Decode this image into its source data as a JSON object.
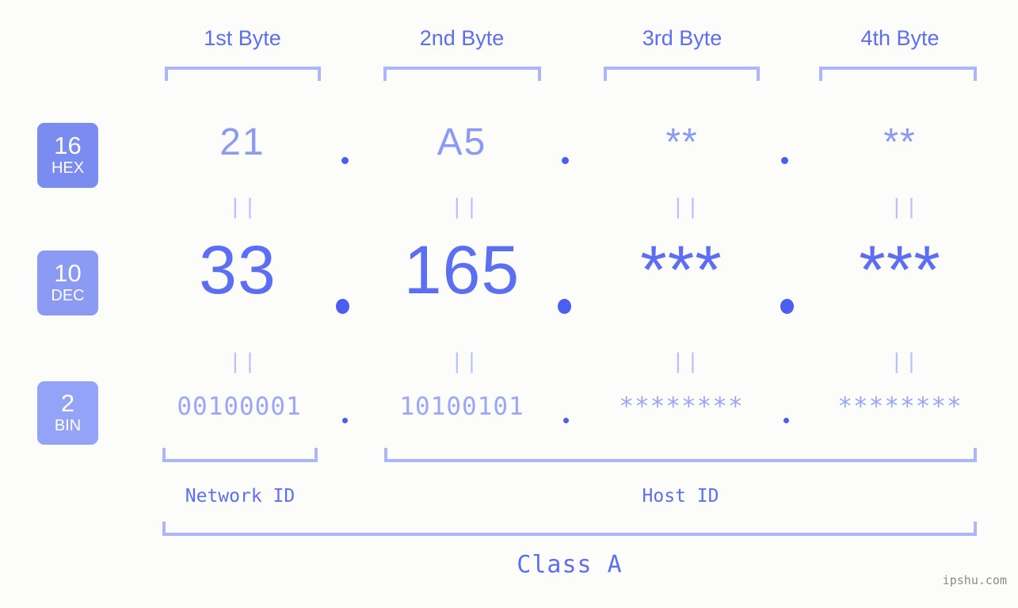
{
  "meta": {
    "background_color": "#fcfdfa",
    "accent_color": "#5c6ff2",
    "accent_light_color": "#8b9af3",
    "bracket_color": "#aeb6fb",
    "watermark": "ipshu.com"
  },
  "header": {
    "byte_labels": [
      "1st Byte",
      "2nd Byte",
      "3rd Byte",
      "4th Byte"
    ]
  },
  "bases": [
    {
      "number": "16",
      "abbr": "HEX",
      "color": "#7b8cf0"
    },
    {
      "number": "10",
      "abbr": "DEC",
      "color": "#8b9af3"
    },
    {
      "number": "2",
      "abbr": "BIN",
      "color": "#93a3f7"
    }
  ],
  "rows": {
    "hex": {
      "values": [
        "21",
        "A5",
        "**",
        "**"
      ],
      "separator": "."
    },
    "dec": {
      "values": [
        "33",
        "165",
        "***",
        "***"
      ],
      "separator": "."
    },
    "bin": {
      "values": [
        "00100001",
        "10100101",
        "********",
        "********"
      ],
      "separator": "."
    }
  },
  "equals_marks": {
    "glyph": "||",
    "count_per_row": 4,
    "rows": 2
  },
  "segments": {
    "network_id": "Network ID",
    "host_id": "Host ID",
    "class": "Class A"
  }
}
